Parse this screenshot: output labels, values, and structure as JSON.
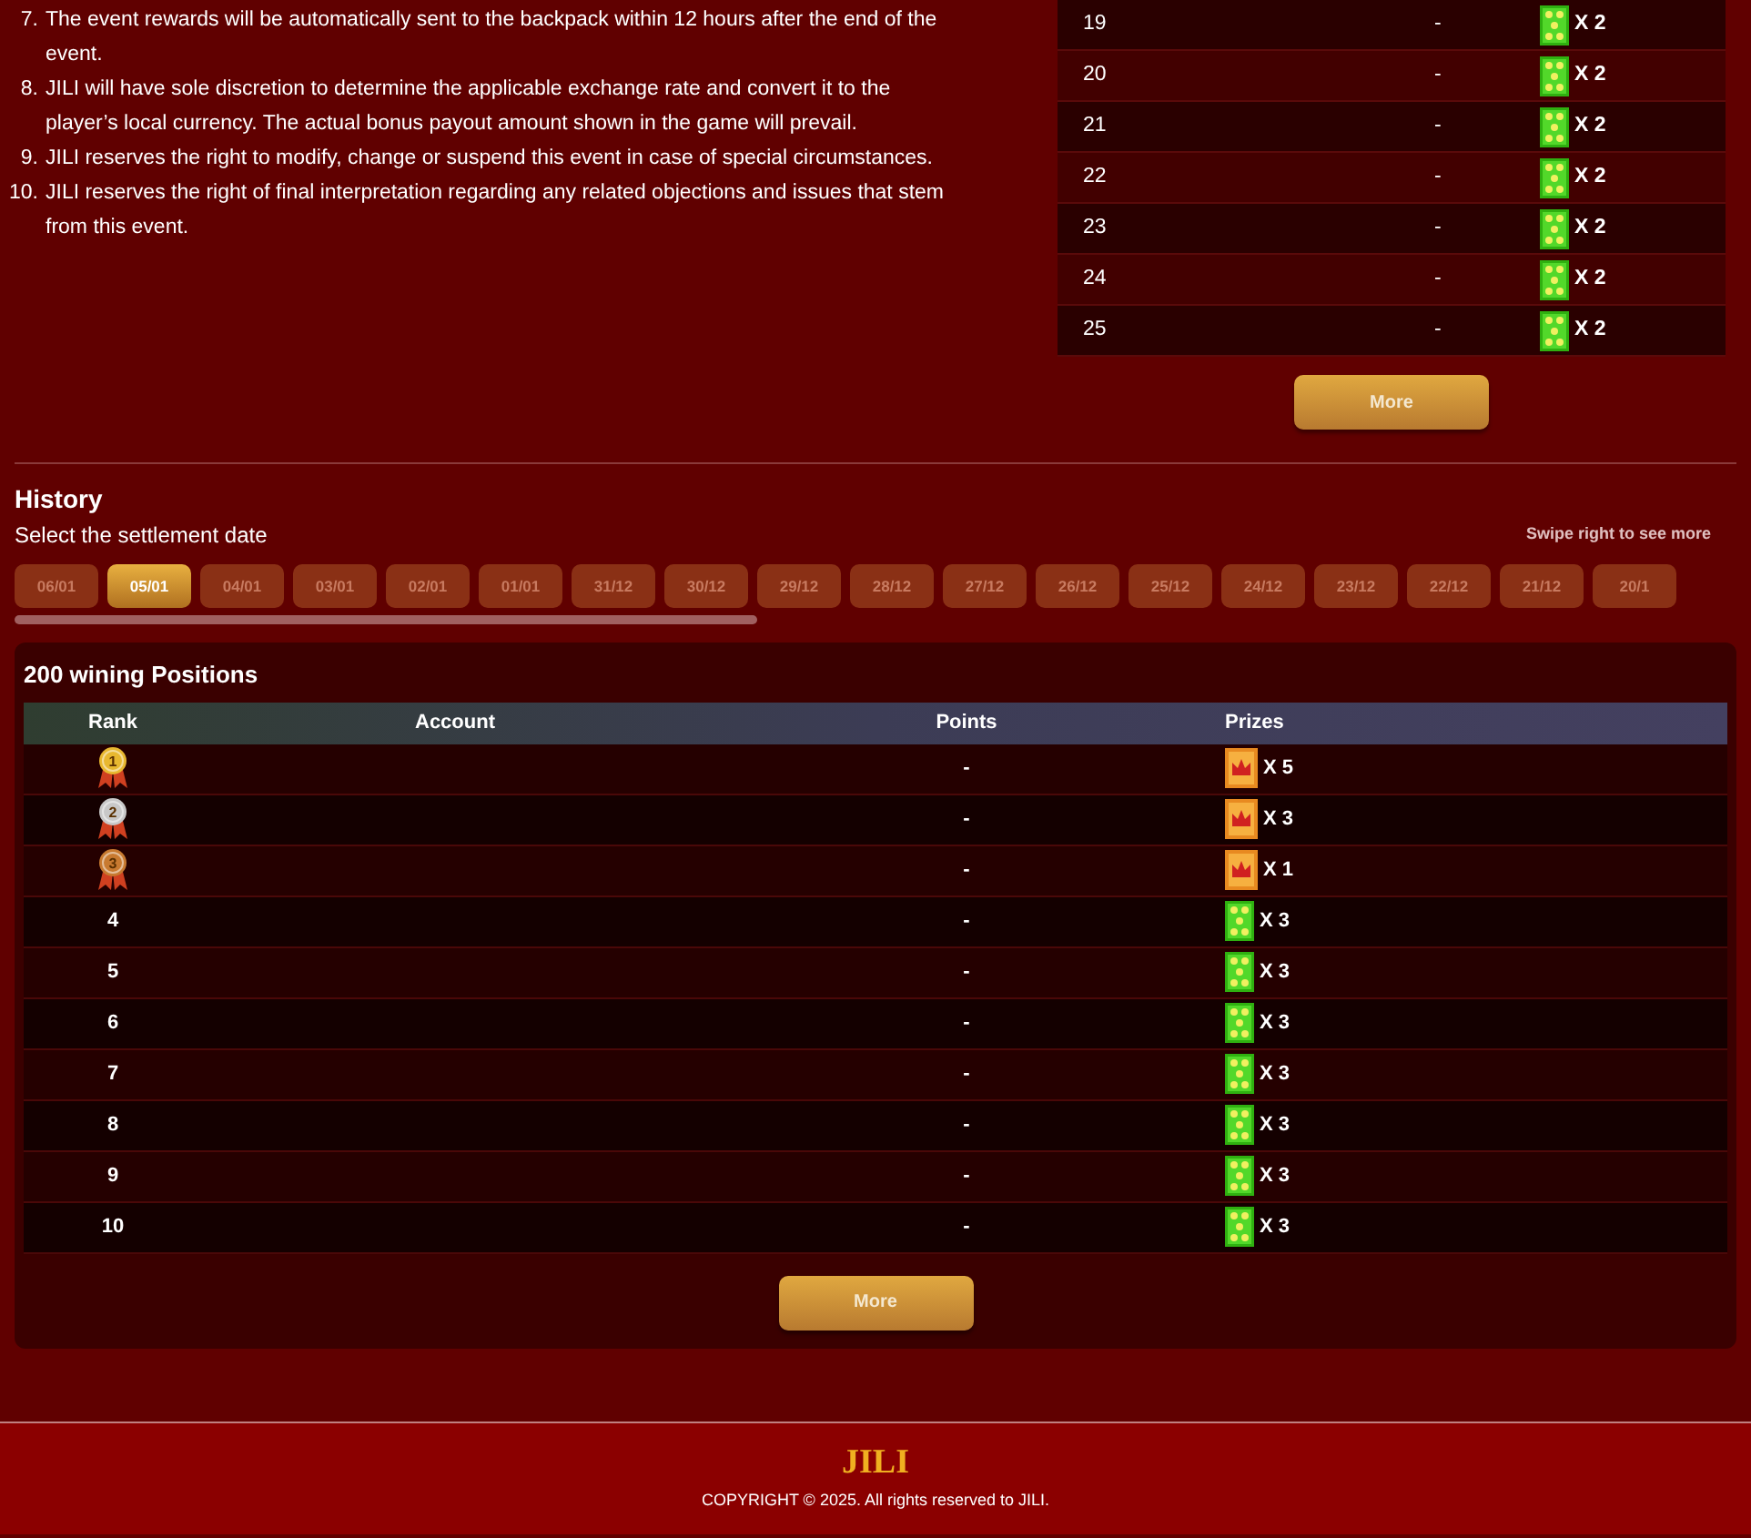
{
  "rules": [
    {
      "number": "7.",
      "text": "The event rewards will be automatically sent to the backpack within 12 hours after the end of the event."
    },
    {
      "number": "8.",
      "text": "JILI will have sole discretion to determine the applicable exchange rate and convert it to the player’s local currency. The actual bonus payout amount shown in the game will prevail."
    },
    {
      "number": "9.",
      "text": "JILI reserves the right to modify, change or suspend this event in case of special circumstances."
    },
    {
      "number": "10.",
      "text": "JILI reserves the right of final interpretation regarding any related objections and issues that stem from this event."
    }
  ],
  "current_table": {
    "rows": [
      {
        "rank": "19",
        "points": "-",
        "prize": {
          "kind": "star",
          "count": "X 2"
        }
      },
      {
        "rank": "20",
        "points": "-",
        "prize": {
          "kind": "star",
          "count": "X 2"
        }
      },
      {
        "rank": "21",
        "points": "-",
        "prize": {
          "kind": "star",
          "count": "X 2"
        }
      },
      {
        "rank": "22",
        "points": "-",
        "prize": {
          "kind": "star",
          "count": "X 2"
        }
      },
      {
        "rank": "23",
        "points": "-",
        "prize": {
          "kind": "star",
          "count": "X 2"
        }
      },
      {
        "rank": "24",
        "points": "-",
        "prize": {
          "kind": "star",
          "count": "X 2"
        }
      },
      {
        "rank": "25",
        "points": "-",
        "prize": {
          "kind": "star",
          "count": "X 2"
        }
      }
    ],
    "more_button": "More"
  },
  "history": {
    "title": "History",
    "subtitle": "Select the settlement date",
    "hint": "Swipe right to see more",
    "dates": [
      {
        "label": "06/01",
        "selected": false
      },
      {
        "label": "05/01",
        "selected": true
      },
      {
        "label": "04/01",
        "selected": false
      },
      {
        "label": "03/01",
        "selected": false
      },
      {
        "label": "02/01",
        "selected": false
      },
      {
        "label": "01/01",
        "selected": false
      },
      {
        "label": "31/12",
        "selected": false
      },
      {
        "label": "30/12",
        "selected": false
      },
      {
        "label": "29/12",
        "selected": false
      },
      {
        "label": "28/12",
        "selected": false
      },
      {
        "label": "27/12",
        "selected": false
      },
      {
        "label": "26/12",
        "selected": false
      },
      {
        "label": "25/12",
        "selected": false
      },
      {
        "label": "24/12",
        "selected": false
      },
      {
        "label": "23/12",
        "selected": false
      },
      {
        "label": "22/12",
        "selected": false
      },
      {
        "label": "21/12",
        "selected": false
      },
      {
        "label": "20/1",
        "selected": false
      }
    ]
  },
  "winners": {
    "title": "200 wining Positions",
    "columns": [
      "Rank",
      "Account",
      "Points",
      "Prizes"
    ],
    "rows": [
      {
        "kind": "medal",
        "color": "#e8b830",
        "rank": "1",
        "points": "-",
        "prize": {
          "kind": "crown",
          "count": "X 5"
        }
      },
      {
        "kind": "medal",
        "color": "#c8c8c8",
        "rank": "2",
        "points": "-",
        "prize": {
          "kind": "crown",
          "count": "X 3"
        }
      },
      {
        "kind": "medal",
        "color": "#c87a30",
        "rank": "3",
        "points": "-",
        "prize": {
          "kind": "crown",
          "count": "X 1"
        }
      },
      {
        "kind": "number",
        "rank": "4",
        "points": "-",
        "prize": {
          "kind": "star",
          "count": "X 3"
        }
      },
      {
        "kind": "number",
        "rank": "5",
        "points": "-",
        "prize": {
          "kind": "star",
          "count": "X 3"
        }
      },
      {
        "kind": "number",
        "rank": "6",
        "points": "-",
        "prize": {
          "kind": "star",
          "count": "X 3"
        }
      },
      {
        "kind": "number",
        "rank": "7",
        "points": "-",
        "prize": {
          "kind": "star",
          "count": "X 3"
        }
      },
      {
        "kind": "number",
        "rank": "8",
        "points": "-",
        "prize": {
          "kind": "star",
          "count": "X 3"
        }
      },
      {
        "kind": "number",
        "rank": "9",
        "points": "-",
        "prize": {
          "kind": "star",
          "count": "X 3"
        }
      },
      {
        "kind": "number",
        "rank": "10",
        "points": "-",
        "prize": {
          "kind": "star",
          "count": "X 3"
        }
      }
    ],
    "more_button": "More"
  },
  "footer": {
    "logo": "JILI",
    "copyright": "COPYRIGHT © 2025. All rights reserved to JILI."
  }
}
